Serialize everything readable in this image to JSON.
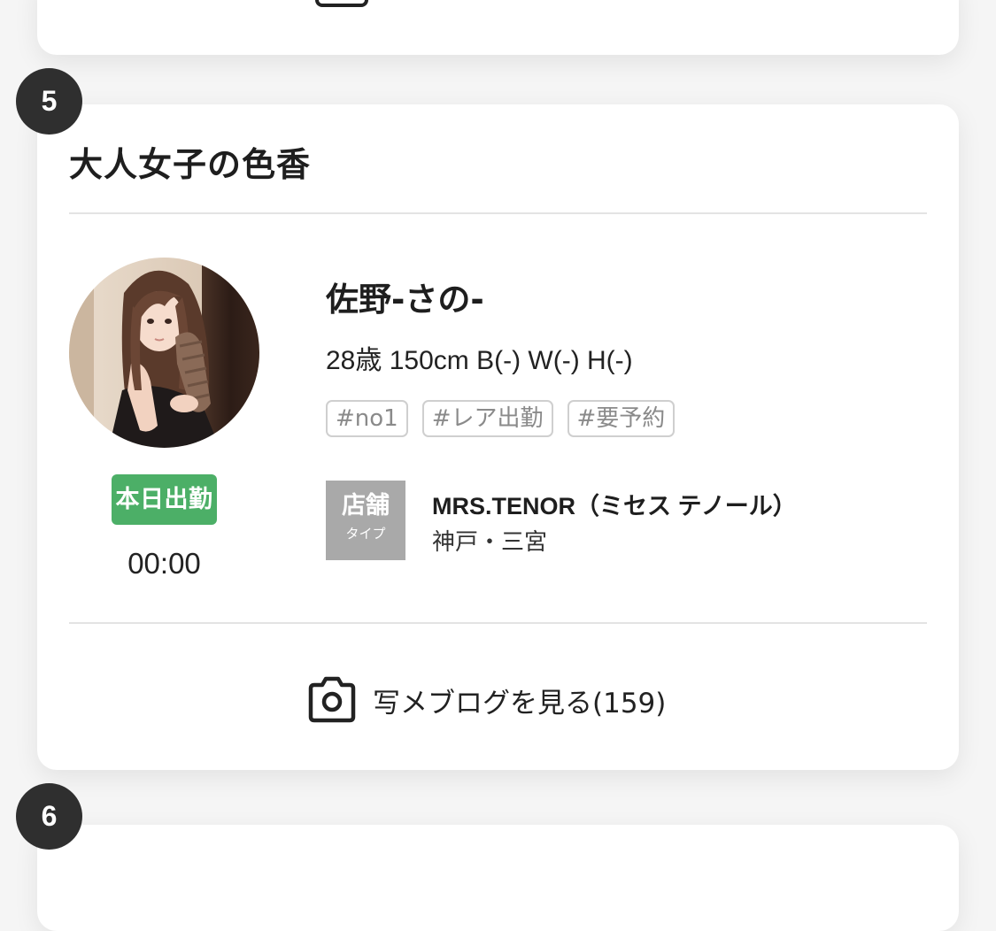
{
  "ranks": {
    "current": "5",
    "next": "6"
  },
  "shop": {
    "name": "大人女子の色香"
  },
  "girl": {
    "name": "佐野-さの-",
    "profile": "28歳 150cm B(-) W(-) H(-)",
    "tags": [
      "#no1",
      "#レア出勤",
      "#要予約"
    ]
  },
  "attendance": {
    "label": "本日出勤",
    "time": "00:00",
    "color": "#4caf67"
  },
  "store": {
    "type_main": "店舗",
    "type_sub": "タイプ",
    "name": "MRS.TENOR（ミセス テノール）",
    "area": "神戸・三宮"
  },
  "blog": {
    "label": "写メブログを見る(159)",
    "icon": "camera-icon"
  }
}
